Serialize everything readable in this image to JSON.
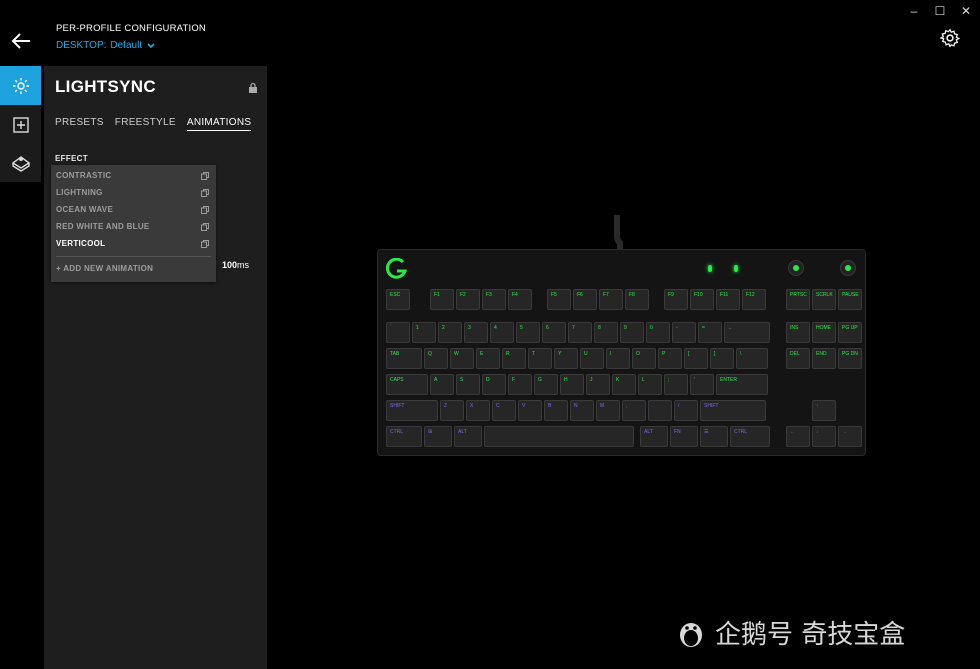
{
  "window_controls": {
    "minimize": "–",
    "maximize": "☐",
    "close": "✕"
  },
  "header": {
    "title": "PER-PROFILE CONFIGURATION",
    "profile_label": "DESKTOP:",
    "profile_value": "Default"
  },
  "left_nav": {
    "items": [
      {
        "icon": "lightsync-sun-icon",
        "active": true
      },
      {
        "icon": "add-macro-icon",
        "active": false
      },
      {
        "icon": "game-mode-icon",
        "active": false
      }
    ]
  },
  "panel": {
    "title": "LIGHTSYNC",
    "tabs": [
      {
        "label": "PRESETS",
        "active": false
      },
      {
        "label": "FREESTYLE",
        "active": false
      },
      {
        "label": "ANIMATIONS",
        "active": true
      }
    ],
    "effect_label": "EFFECT",
    "animations": [
      {
        "label": "CONTRASTIC",
        "selected": false
      },
      {
        "label": "LIGHTNING",
        "selected": false
      },
      {
        "label": "OCEAN WAVE",
        "selected": false
      },
      {
        "label": "RED WHITE AND BLUE",
        "selected": false
      },
      {
        "label": "VERTICOOL",
        "selected": true
      }
    ],
    "add_new": "+ ADD NEW ANIMATION",
    "speed_value": "100",
    "speed_unit": "ms"
  },
  "keyboard": {
    "accent_color": "#2ee84a",
    "secondary_color": "#7a6cf0",
    "rows": [
      [
        [
          "ESC",
          "ESC"
        ]
      ],
      [
        [
          "F1",
          "F1"
        ],
        [
          "F2",
          "F2"
        ],
        [
          "F3",
          "F3"
        ],
        [
          "F4",
          "F4"
        ],
        [
          "F5",
          "F5"
        ],
        [
          "F6",
          "F6"
        ],
        [
          "F7",
          "F7"
        ],
        [
          "F8",
          "F8"
        ],
        [
          "F9",
          "F9"
        ],
        [
          "F10",
          "F10"
        ],
        [
          "F11",
          "F11"
        ],
        [
          "F12",
          "F12"
        ],
        [
          "PRTSC",
          "PRTSC"
        ],
        [
          "SCRLK",
          "SCRLK"
        ],
        [
          "PAUSE",
          "PAUSE"
        ]
      ]
    ],
    "row1": [
      "`",
      "1",
      "2",
      "3",
      "4",
      "5",
      "6",
      "7",
      "8",
      "9",
      "0",
      "-",
      "=",
      "←",
      "INS",
      "HOME",
      "PG UP"
    ],
    "row2": [
      "TAB",
      "Q",
      "W",
      "E",
      "R",
      "T",
      "Y",
      "U",
      "I",
      "O",
      "P",
      "[",
      "]",
      "\\",
      "DEL",
      "END",
      "PG DN"
    ],
    "row3": [
      "CAPS",
      "A",
      "S",
      "D",
      "F",
      "G",
      "H",
      "J",
      "K",
      "L",
      ";",
      "'",
      "ENTER"
    ],
    "row4": [
      "SHIFT",
      "Z",
      "X",
      "C",
      "V",
      "B",
      "N",
      "M",
      ",",
      ".",
      "/",
      "SHIFT",
      "↑"
    ],
    "row5": [
      "CTRL",
      "⊞",
      "ALT",
      "",
      "ALT",
      "FN",
      "☰",
      "CTRL",
      "←",
      "↓",
      "→"
    ]
  },
  "watermark": {
    "text": "企鹅号 奇技宝盒"
  }
}
